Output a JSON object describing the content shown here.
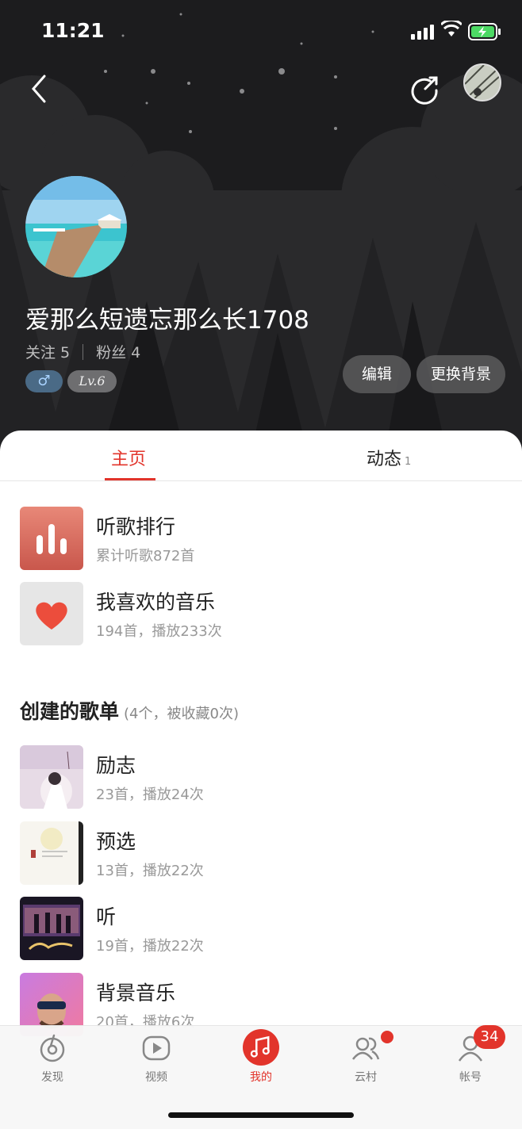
{
  "status_bar": {
    "time": "11:21"
  },
  "profile": {
    "username": "爱那么短遗忘那么长1708",
    "following": "关注 5",
    "followers": "粉丝 4",
    "gender_badge": "♂",
    "level_badge": "Lv.6",
    "edit_label": "编辑",
    "change_bg_label": "更换背景"
  },
  "tabs": [
    {
      "label": "主页",
      "active": true
    },
    {
      "label": "动态",
      "count": "1"
    }
  ],
  "top_items": [
    {
      "title": "听歌排行",
      "subtitle": "累计听歌872首"
    },
    {
      "title": "我喜欢的音乐",
      "subtitle": "194首，播放233次"
    }
  ],
  "created_section": {
    "title": "创建的歌单",
    "meta": "(4个，被收藏0次)"
  },
  "playlists": [
    {
      "title": "励志",
      "subtitle": "23首，播放24次"
    },
    {
      "title": "预选",
      "subtitle": "13首，播放22次"
    },
    {
      "title": "听",
      "subtitle": "19首，播放22次"
    },
    {
      "title": "背景音乐",
      "subtitle": "20首，播放6次"
    }
  ],
  "tabbar": [
    {
      "label": "发现",
      "icon": "discover-icon"
    },
    {
      "label": "视频",
      "icon": "video-icon"
    },
    {
      "label": "我的",
      "icon": "music-note-icon",
      "active": true
    },
    {
      "label": "云村",
      "icon": "community-icon",
      "has_dot": true
    },
    {
      "label": "帐号",
      "icon": "account-icon",
      "badge": "34"
    }
  ],
  "colors": {
    "accent": "#e2342b",
    "header_bg": "#1e1e20"
  }
}
